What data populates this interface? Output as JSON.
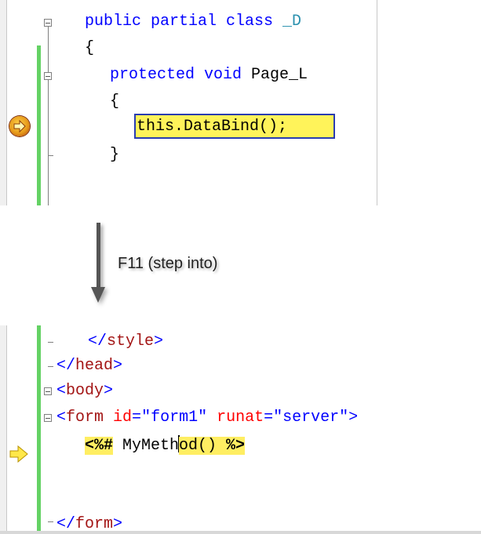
{
  "top_code": {
    "line1": {
      "kw": "public partial class ",
      "type": "_D"
    },
    "line2": "{",
    "line3": {
      "kw": "protected void ",
      "name": "Page_L"
    },
    "line4": "{",
    "line5": "this.DataBind();",
    "line6": "}"
  },
  "annotation": {
    "step_label": "F11 (step into)"
  },
  "bottom_code": {
    "line1": {
      "open": "</",
      "tag": "style",
      "close": ">"
    },
    "line2": {
      "open": "</",
      "tag": "head",
      "close": ">"
    },
    "line3": {
      "open": "<",
      "tag": "body",
      "close": ">"
    },
    "line4": {
      "open": "<",
      "tag": "form",
      "attr1": " id",
      "eq1": "=",
      "val1": "\"form1\"",
      "attr2": " runat",
      "eq2": "=",
      "val2": "\"server\"",
      "close": ">"
    },
    "line5": {
      "open_delim": "<%#",
      "code_a": " MyMeth",
      "code_b": "od() ",
      "close_delim": "%>"
    },
    "line6": {
      "open": "</",
      "tag": "form",
      "close": ">"
    }
  },
  "colors": {
    "keyword": "#0000ff",
    "type": "#2b91af",
    "html_tag": "#a31515",
    "html_attr": "#ff0000",
    "current_statement_highlight": "#fff35a",
    "change_bar": "#64d264"
  }
}
